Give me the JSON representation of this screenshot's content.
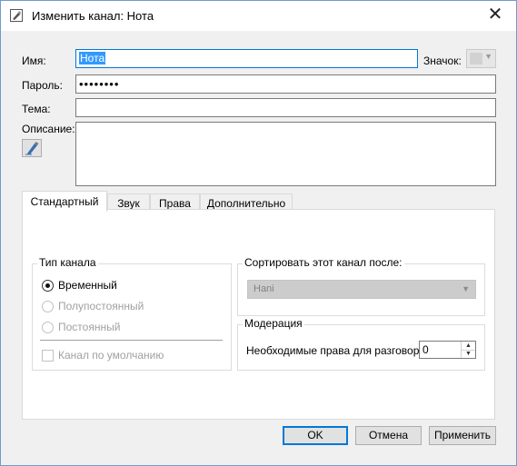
{
  "window": {
    "title": "Изменить канал: Нота",
    "close_glyph": "✕"
  },
  "form": {
    "name_label": "Имя:",
    "name_value": "Нота",
    "icon_label": "Значок:",
    "password_label": "Пароль:",
    "password_value": "••••••••",
    "topic_label": "Тема:",
    "topic_value": "",
    "description_label": "Описание:",
    "description_value": ""
  },
  "tabs": [
    {
      "label": "Стандартный",
      "active": true
    },
    {
      "label": "Звук",
      "active": false
    },
    {
      "label": "Права",
      "active": false
    },
    {
      "label": "Дополнительно",
      "active": false
    }
  ],
  "channel_type": {
    "title": "Тип канала",
    "options": [
      {
        "label": "Временный",
        "selected": true,
        "enabled": true
      },
      {
        "label": "Полупостоянный",
        "selected": false,
        "enabled": false
      },
      {
        "label": "Постоянный",
        "selected": false,
        "enabled": false
      }
    ],
    "default_checkbox_label": "Канал по умолчанию",
    "default_checked": false
  },
  "sort": {
    "title": "Сортировать этот канал после:",
    "selected": "Hani"
  },
  "moderation": {
    "title": "Модерация",
    "talk_power_label": "Необходимые права для разговора:",
    "talk_power_value": "0"
  },
  "buttons": {
    "ok": "OK",
    "cancel": "Отмена",
    "apply": "Применить"
  },
  "icons": {
    "title": "channel-edit-icon",
    "close": "close-icon",
    "description": "pen-edit-icon",
    "combo_arrow": "▼",
    "spin_up": "▲",
    "spin_down": "▼"
  },
  "colors": {
    "accent": "#0078d7",
    "selection": "#3399ff"
  }
}
